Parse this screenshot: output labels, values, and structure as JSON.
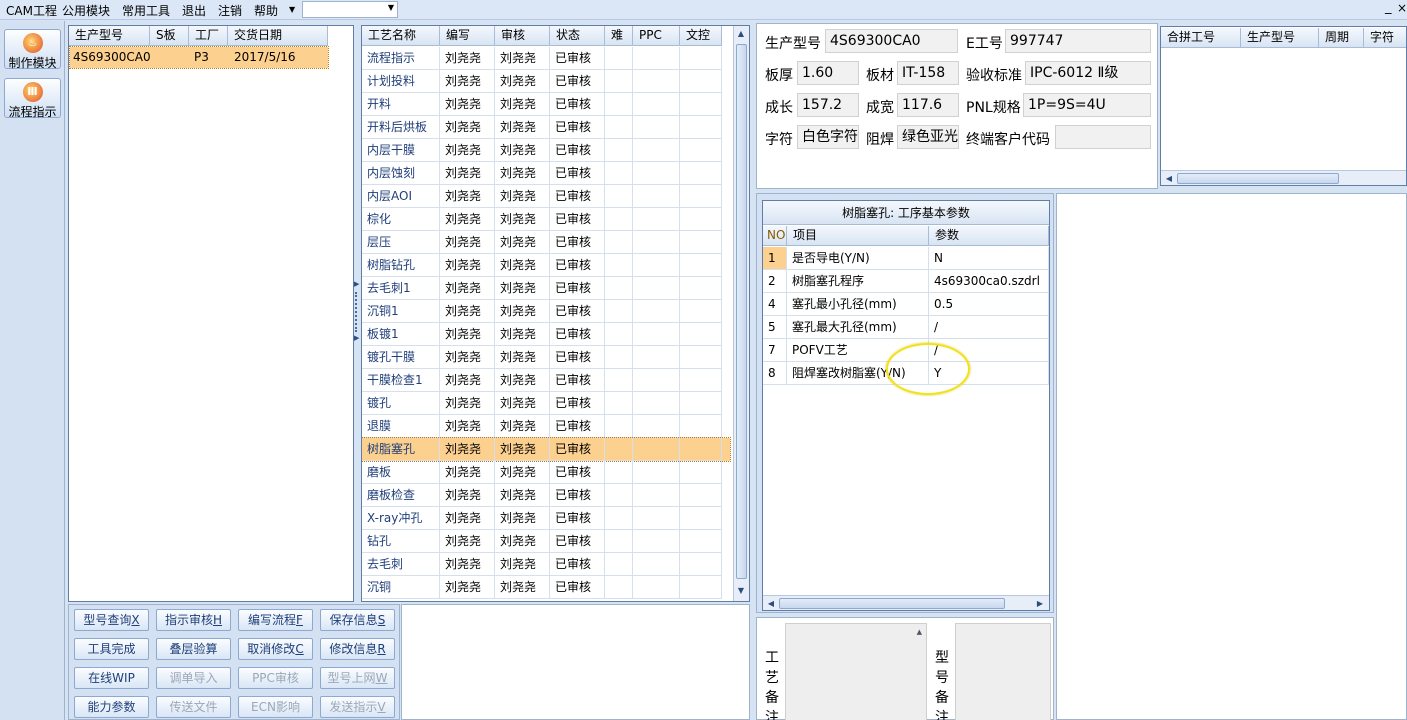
{
  "menu": [
    "CAM工程",
    "公用模块",
    "常用工具",
    "退出",
    "注销",
    "帮助"
  ],
  "nav": {
    "make_module": "制作模块",
    "flow_guide": "流程指示"
  },
  "models_grid": {
    "headers": [
      "生产型号",
      "S板",
      "工厂",
      "交货日期"
    ],
    "rows": [
      [
        "4S69300CA0",
        "",
        "P3",
        "2017/5/16"
      ]
    ]
  },
  "process_grid": {
    "headers": [
      "工艺名称",
      "编写",
      "审核",
      "状态",
      "难",
      "PPC",
      "文控"
    ],
    "rows": [
      [
        "流程指示",
        "刘尧尧",
        "刘尧尧",
        "已审核"
      ],
      [
        "计划投料",
        "刘尧尧",
        "刘尧尧",
        "已审核"
      ],
      [
        "开料",
        "刘尧尧",
        "刘尧尧",
        "已审核"
      ],
      [
        "开料后烘板",
        "刘尧尧",
        "刘尧尧",
        "已审核"
      ],
      [
        "内层干膜",
        "刘尧尧",
        "刘尧尧",
        "已审核"
      ],
      [
        "内层蚀刻",
        "刘尧尧",
        "刘尧尧",
        "已审核"
      ],
      [
        "内层AOI",
        "刘尧尧",
        "刘尧尧",
        "已审核"
      ],
      [
        "棕化",
        "刘尧尧",
        "刘尧尧",
        "已审核"
      ],
      [
        "层压",
        "刘尧尧",
        "刘尧尧",
        "已审核"
      ],
      [
        "树脂钻孔",
        "刘尧尧",
        "刘尧尧",
        "已审核"
      ],
      [
        "去毛刺1",
        "刘尧尧",
        "刘尧尧",
        "已审核"
      ],
      [
        "沉铜1",
        "刘尧尧",
        "刘尧尧",
        "已审核"
      ],
      [
        "板镀1",
        "刘尧尧",
        "刘尧尧",
        "已审核"
      ],
      [
        "镀孔干膜",
        "刘尧尧",
        "刘尧尧",
        "已审核"
      ],
      [
        "干膜检查1",
        "刘尧尧",
        "刘尧尧",
        "已审核"
      ],
      [
        "镀孔",
        "刘尧尧",
        "刘尧尧",
        "已审核"
      ],
      [
        "退膜",
        "刘尧尧",
        "刘尧尧",
        "已审核"
      ],
      [
        "树脂塞孔",
        "刘尧尧",
        "刘尧尧",
        "已审核"
      ],
      [
        "磨板",
        "刘尧尧",
        "刘尧尧",
        "已审核"
      ],
      [
        "磨板检查",
        "刘尧尧",
        "刘尧尧",
        "已审核"
      ],
      [
        "X-ray冲孔",
        "刘尧尧",
        "刘尧尧",
        "已审核"
      ],
      [
        "钻孔",
        "刘尧尧",
        "刘尧尧",
        "已审核"
      ],
      [
        "去毛刺",
        "刘尧尧",
        "刘尧尧",
        "已审核"
      ],
      [
        "沉铜",
        "刘尧尧",
        "刘尧尧",
        "已审核"
      ]
    ],
    "selected_index": 17
  },
  "buttons": [
    {
      "label": "型号查询",
      "key": "X",
      "enabled": true
    },
    {
      "label": "指示审核",
      "key": "H",
      "enabled": true
    },
    {
      "label": "编写流程",
      "key": "F",
      "enabled": true
    },
    {
      "label": "保存信息",
      "key": "S",
      "enabled": true
    },
    {
      "label": "工具完成",
      "key": "",
      "enabled": true
    },
    {
      "label": "叠层验算",
      "key": "",
      "enabled": true
    },
    {
      "label": "取消修改",
      "key": "C",
      "enabled": true
    },
    {
      "label": "修改信息",
      "key": "R",
      "enabled": true
    },
    {
      "label": "在线WIP",
      "key": "",
      "enabled": true
    },
    {
      "label": "调单导入",
      "key": "",
      "enabled": false
    },
    {
      "label": "PPC审核",
      "key": "",
      "enabled": false
    },
    {
      "label": "型号上网",
      "key": "W",
      "enabled": false
    },
    {
      "label": "能力参数",
      "key": "",
      "enabled": true
    },
    {
      "label": "传送文件",
      "key": "",
      "enabled": false
    },
    {
      "label": "ECN影响",
      "key": "",
      "enabled": false
    },
    {
      "label": "发送指示",
      "key": "V",
      "enabled": false
    }
  ],
  "info": {
    "prod_model_label": "生产型号",
    "prod_model": "4S69300CA0",
    "e_no_label": "E工号",
    "e_no": "997747",
    "thickness_label": "板厚",
    "thickness": "1.60",
    "material_label": "板材",
    "material": "IT-158",
    "standard_label": "验收标准",
    "standard": "IPC-6012 Ⅱ级",
    "length_label": "成长",
    "length": "157.2",
    "width_label": "成宽",
    "width": "117.6",
    "pnl_label": "PNL规格",
    "pnl": "1P=9S=4U",
    "char_label": "字符",
    "char": "白色字符",
    "mask_label": "阻焊",
    "mask": "绿色亚光",
    "customer_label": "终端客户代码",
    "customer": ""
  },
  "merge_grid": {
    "headers": [
      "合拼工号",
      "生产型号",
      "周期",
      "字符"
    ]
  },
  "params": {
    "title": "树脂塞孔: 工序基本参数",
    "headers": [
      "NO",
      "项目",
      "参数"
    ],
    "rows": [
      [
        "1",
        "是否导电(Y/N)",
        "N"
      ],
      [
        "2",
        "树脂塞孔程序",
        "4s69300ca0.szdrl"
      ],
      [
        "4",
        "塞孔最小孔径(mm)",
        "0.5"
      ],
      [
        "5",
        "塞孔最大孔径(mm)",
        "/"
      ],
      [
        "7",
        "POFV工艺",
        "/"
      ],
      [
        "8",
        "阻焊塞改树脂塞(Y/N)",
        "Y"
      ]
    ]
  },
  "notes": {
    "process_note_label": "工艺备注",
    "model_note_label": "型号备注"
  },
  "window_controls": {
    "minimize": "_",
    "close": "×"
  },
  "colors": {
    "selected_row": "#fcd08e",
    "header_bg": "#d8e4f3",
    "accent_border": "#5f7da8",
    "highlight_circle": "#f2e21a"
  }
}
